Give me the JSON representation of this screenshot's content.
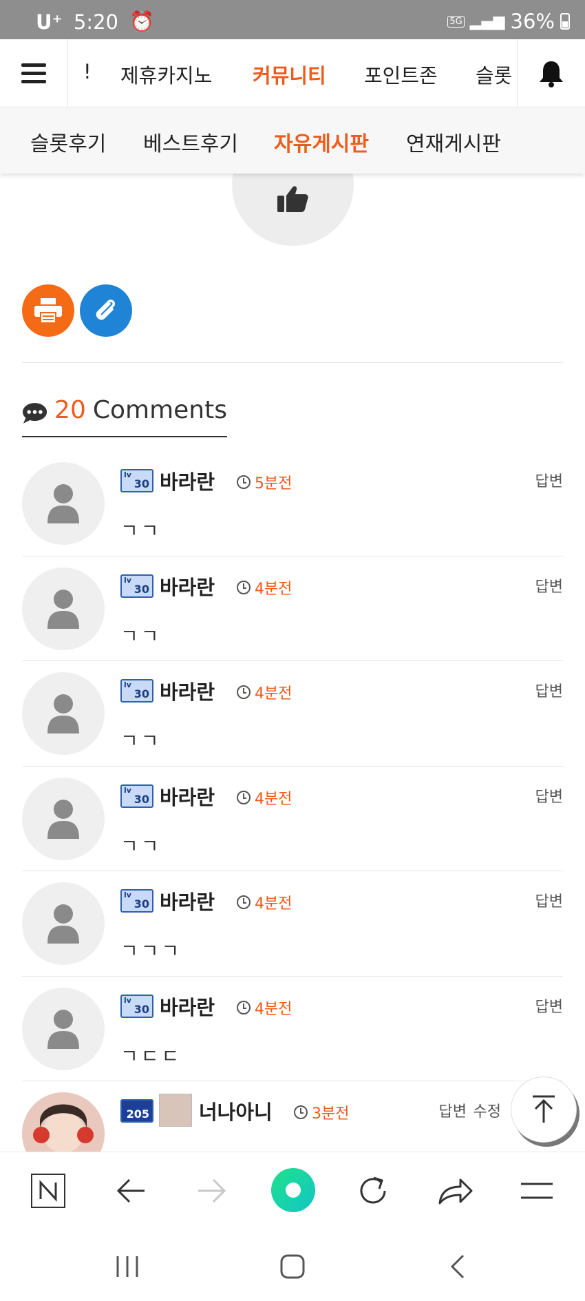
{
  "status_bar": {
    "carrier": "U⁺",
    "time": "5:20",
    "network": "5G",
    "battery": "36%"
  },
  "top_nav": {
    "items": [
      "!",
      "제휴카지노",
      "커뮤니티",
      "포인트존",
      "슬롯"
    ],
    "active": "커뮤니티"
  },
  "sub_nav": {
    "items": [
      "슬롯후기",
      "베스트후기",
      "자유게시판",
      "연재게시판"
    ],
    "active": "자유게시판"
  },
  "comments_section": {
    "count": "20",
    "label": "Comments"
  },
  "comments": [
    {
      "level": "30",
      "name": "바라란",
      "time": "5분전",
      "reply": "답변",
      "text": "ㄱㄱ"
    },
    {
      "level": "30",
      "name": "바라란",
      "time": "4분전",
      "reply": "답변",
      "text": "ㄱㄱ"
    },
    {
      "level": "30",
      "name": "바라란",
      "time": "4분전",
      "reply": "답변",
      "text": "ㄱㄱ"
    },
    {
      "level": "30",
      "name": "바라란",
      "time": "4분전",
      "reply": "답변",
      "text": "ㄱㄱ"
    },
    {
      "level": "30",
      "name": "바라란",
      "time": "4분전",
      "reply": "답변",
      "text": "ㄱㄱㄱ"
    },
    {
      "level": "30",
      "name": "바라란",
      "time": "4분전",
      "reply": "답변",
      "text": "ㄱㄷㄷ"
    },
    {
      "level": "205",
      "name": "너나아니",
      "time": "3분전",
      "reply": "답변",
      "edit": "수정",
      "text": ""
    }
  ],
  "colors": {
    "accent": "#f05a1a",
    "print_button": "#f56a14",
    "clip_button": "#1f84d6",
    "browser_home": "#1ed6a0"
  },
  "icons": [
    "menu-icon",
    "bell-icon",
    "thumbs-up-icon",
    "print-icon",
    "paperclip-icon",
    "comment-icon",
    "clock-icon",
    "user-icon",
    "arrow-up-icon",
    "n-icon",
    "back-icon",
    "forward-icon",
    "refresh-icon",
    "share-icon",
    "hamburger-icon"
  ]
}
